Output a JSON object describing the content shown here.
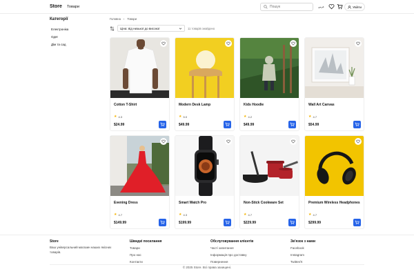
{
  "header": {
    "logo": "Store",
    "nav_products": "Товари",
    "search_placeholder": "Пошук",
    "lang": "عربي",
    "login": "Увійти"
  },
  "sidebar": {
    "title": "Категорії",
    "items": [
      {
        "label": "Електроніка"
      },
      {
        "label": "Одяг"
      },
      {
        "label": "Дім та сад"
      }
    ]
  },
  "breadcrumb": [
    "Головна",
    "Товари"
  ],
  "sort": {
    "selected": "Ціна: від низької до високої",
    "found": "11 товарів знайдено"
  },
  "products": [
    {
      "title": "Cotton T-Shirt",
      "rating": "4.3",
      "price": "$24.99"
    },
    {
      "title": "Modern Desk Lamp",
      "rating": "5.0",
      "price": "$49.99"
    },
    {
      "title": "Kids Hoodie",
      "rating": "4.2",
      "price": "$49.99"
    },
    {
      "title": "Wall Art Canvas",
      "rating": "4.7",
      "price": "$54.99"
    },
    {
      "title": "Evening Dress",
      "rating": "4.7",
      "price": "$149.99"
    },
    {
      "title": "Smart Watch Pro",
      "rating": "4.3",
      "price": "$199.99"
    },
    {
      "title": "Non-Stick Cookware Set",
      "rating": "4.7",
      "price": "$229.99"
    },
    {
      "title": "Premium Wireless Headphones",
      "rating": "4.7",
      "price": "$299.99"
    }
  ],
  "footer": {
    "about": {
      "title": "Store",
      "desc": "Ваш універсальний магазин наших якісних товарів."
    },
    "quick": {
      "title": "Швидкі посилання",
      "links": [
        "Товари",
        "Про нас",
        "Контакти"
      ]
    },
    "service": {
      "title": "Обслуговування клієнтів",
      "links": [
        "Часті запитання",
        "Інформація про доставку",
        "Повернення"
      ]
    },
    "contact": {
      "title": "Зв'язок з нами",
      "links": [
        "Facebook",
        "Instagram",
        "Twitter/X"
      ]
    },
    "copyright": "© 2025 Store. Всі права захищені."
  },
  "colors": {
    "accent": "#2764e8",
    "star": "#f5b301"
  }
}
